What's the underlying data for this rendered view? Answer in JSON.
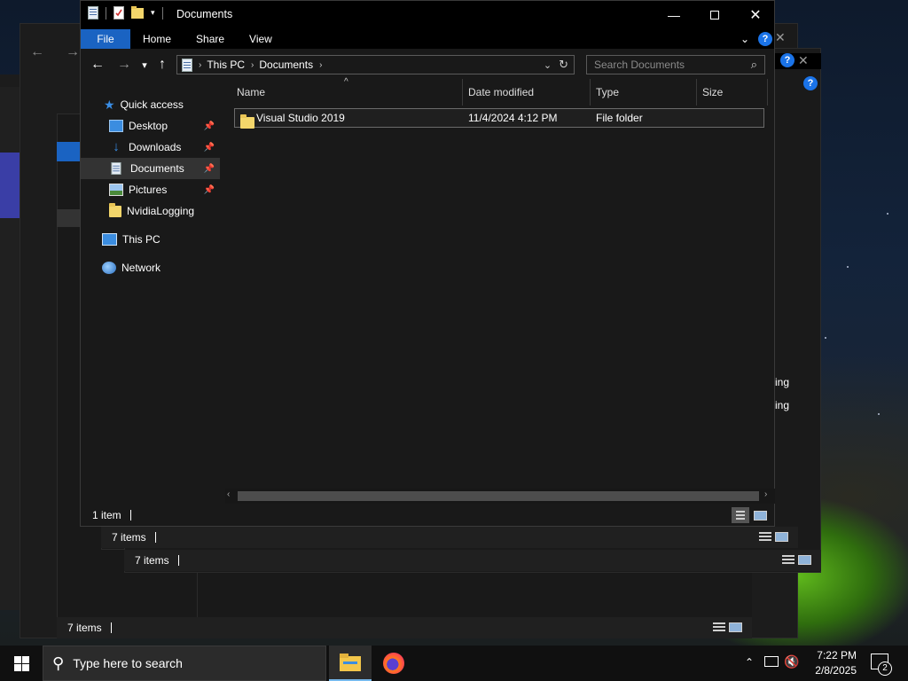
{
  "window": {
    "title": "Documents",
    "ribbon_tabs": [
      "File",
      "Home",
      "Share",
      "View"
    ],
    "address": {
      "crumbs": [
        "This PC",
        "Documents"
      ]
    },
    "search": {
      "placeholder": "Search Documents"
    },
    "nav_pane": {
      "quick_access": "Quick access",
      "pinned": [
        {
          "label": "Desktop",
          "icon": "desktop-icon",
          "pinned": true
        },
        {
          "label": "Downloads",
          "icon": "downloads-icon",
          "pinned": true
        },
        {
          "label": "Documents",
          "icon": "documents-icon",
          "pinned": true,
          "selected": true
        },
        {
          "label": "Pictures",
          "icon": "pictures-icon",
          "pinned": true
        },
        {
          "label": "NvidiaLogging",
          "icon": "folder-icon",
          "pinned": false
        }
      ],
      "this_pc": "This PC",
      "network": "Network"
    },
    "columns": [
      "Name",
      "Date modified",
      "Type",
      "Size"
    ],
    "files": [
      {
        "name": "Visual Studio 2019",
        "date": "11/4/2024 4:12 PM",
        "type": "File folder",
        "size": ""
      }
    ],
    "status": "1 item"
  },
  "background_windows": {
    "status_1": "7 items",
    "status_2": "7 items",
    "status_3": "7 items",
    "fragment_1": "ing",
    "fragment_2": "ing"
  },
  "taskbar": {
    "search_placeholder": "Type here to search",
    "time": "7:22 PM",
    "date": "2/8/2025",
    "notification_count": "2"
  },
  "colors": {
    "accent": "#1a63c2",
    "folder": "#f3d66b",
    "help": "#1a73e8"
  }
}
